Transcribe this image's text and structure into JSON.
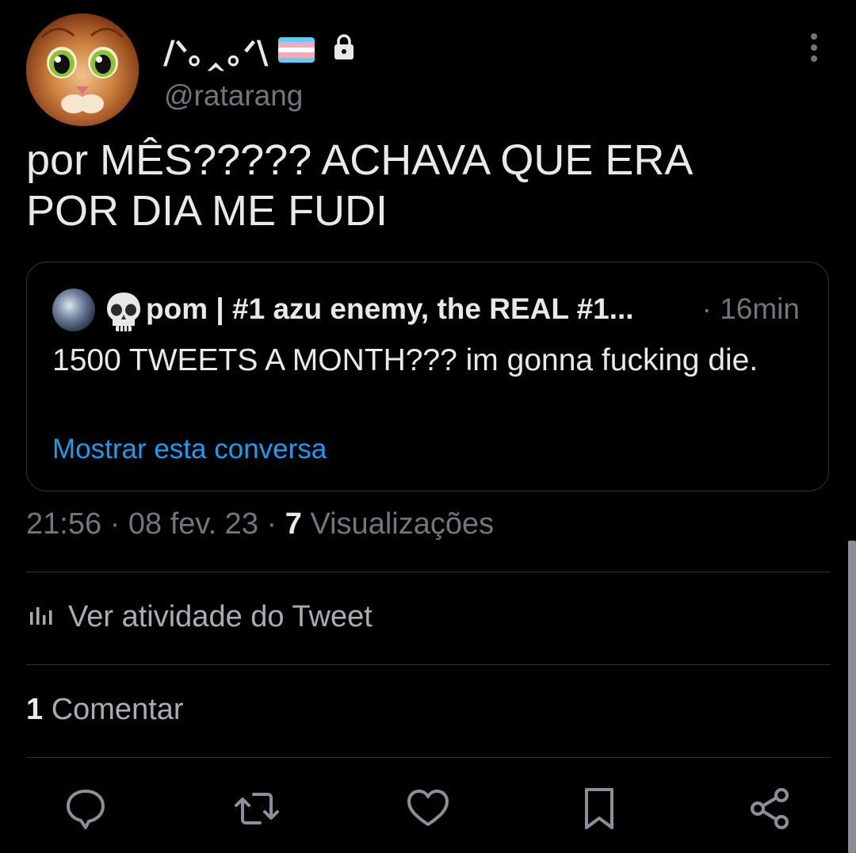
{
  "author": {
    "display_name": "/ᐠ｡‸｡ᐟ\\",
    "handle": "@ratarang",
    "verified_locked": true,
    "flag_colors": [
      "#5BCEFA",
      "#F5A9B8",
      "#FFFFFF",
      "#F5A9B8",
      "#5BCEFA"
    ]
  },
  "tweet": {
    "text": "por MÊS????? ACHAVA QUE ERA\nPOR DIA ME FUDI"
  },
  "quote": {
    "name": "pom | #1 azu enemy, the REAL #1...",
    "time": "· 16min",
    "text": "1500 TWEETS A MONTH??? im gonna fucking die.",
    "show_thread_link": "Mostrar esta conversa",
    "icons": [
      "avatar",
      "skull-emoji"
    ]
  },
  "meta": {
    "time": "21:56",
    "date": "08 fev. 23",
    "separator": "·",
    "views_count": "7",
    "views_label": "Visualizações"
  },
  "activity": {
    "label": "Ver atividade do Tweet",
    "icon": "analytics-icon"
  },
  "comments": {
    "count": "1",
    "label": "Comentar"
  },
  "actions": [
    "reply-icon",
    "retweet-icon",
    "like-icon",
    "bookmark-icon",
    "share-icon"
  ],
  "colors": {
    "background": "#000000",
    "text": "#e7e9ea",
    "secondary": "#71767b",
    "link": "#1d9bf0",
    "border": "#2f3336"
  }
}
